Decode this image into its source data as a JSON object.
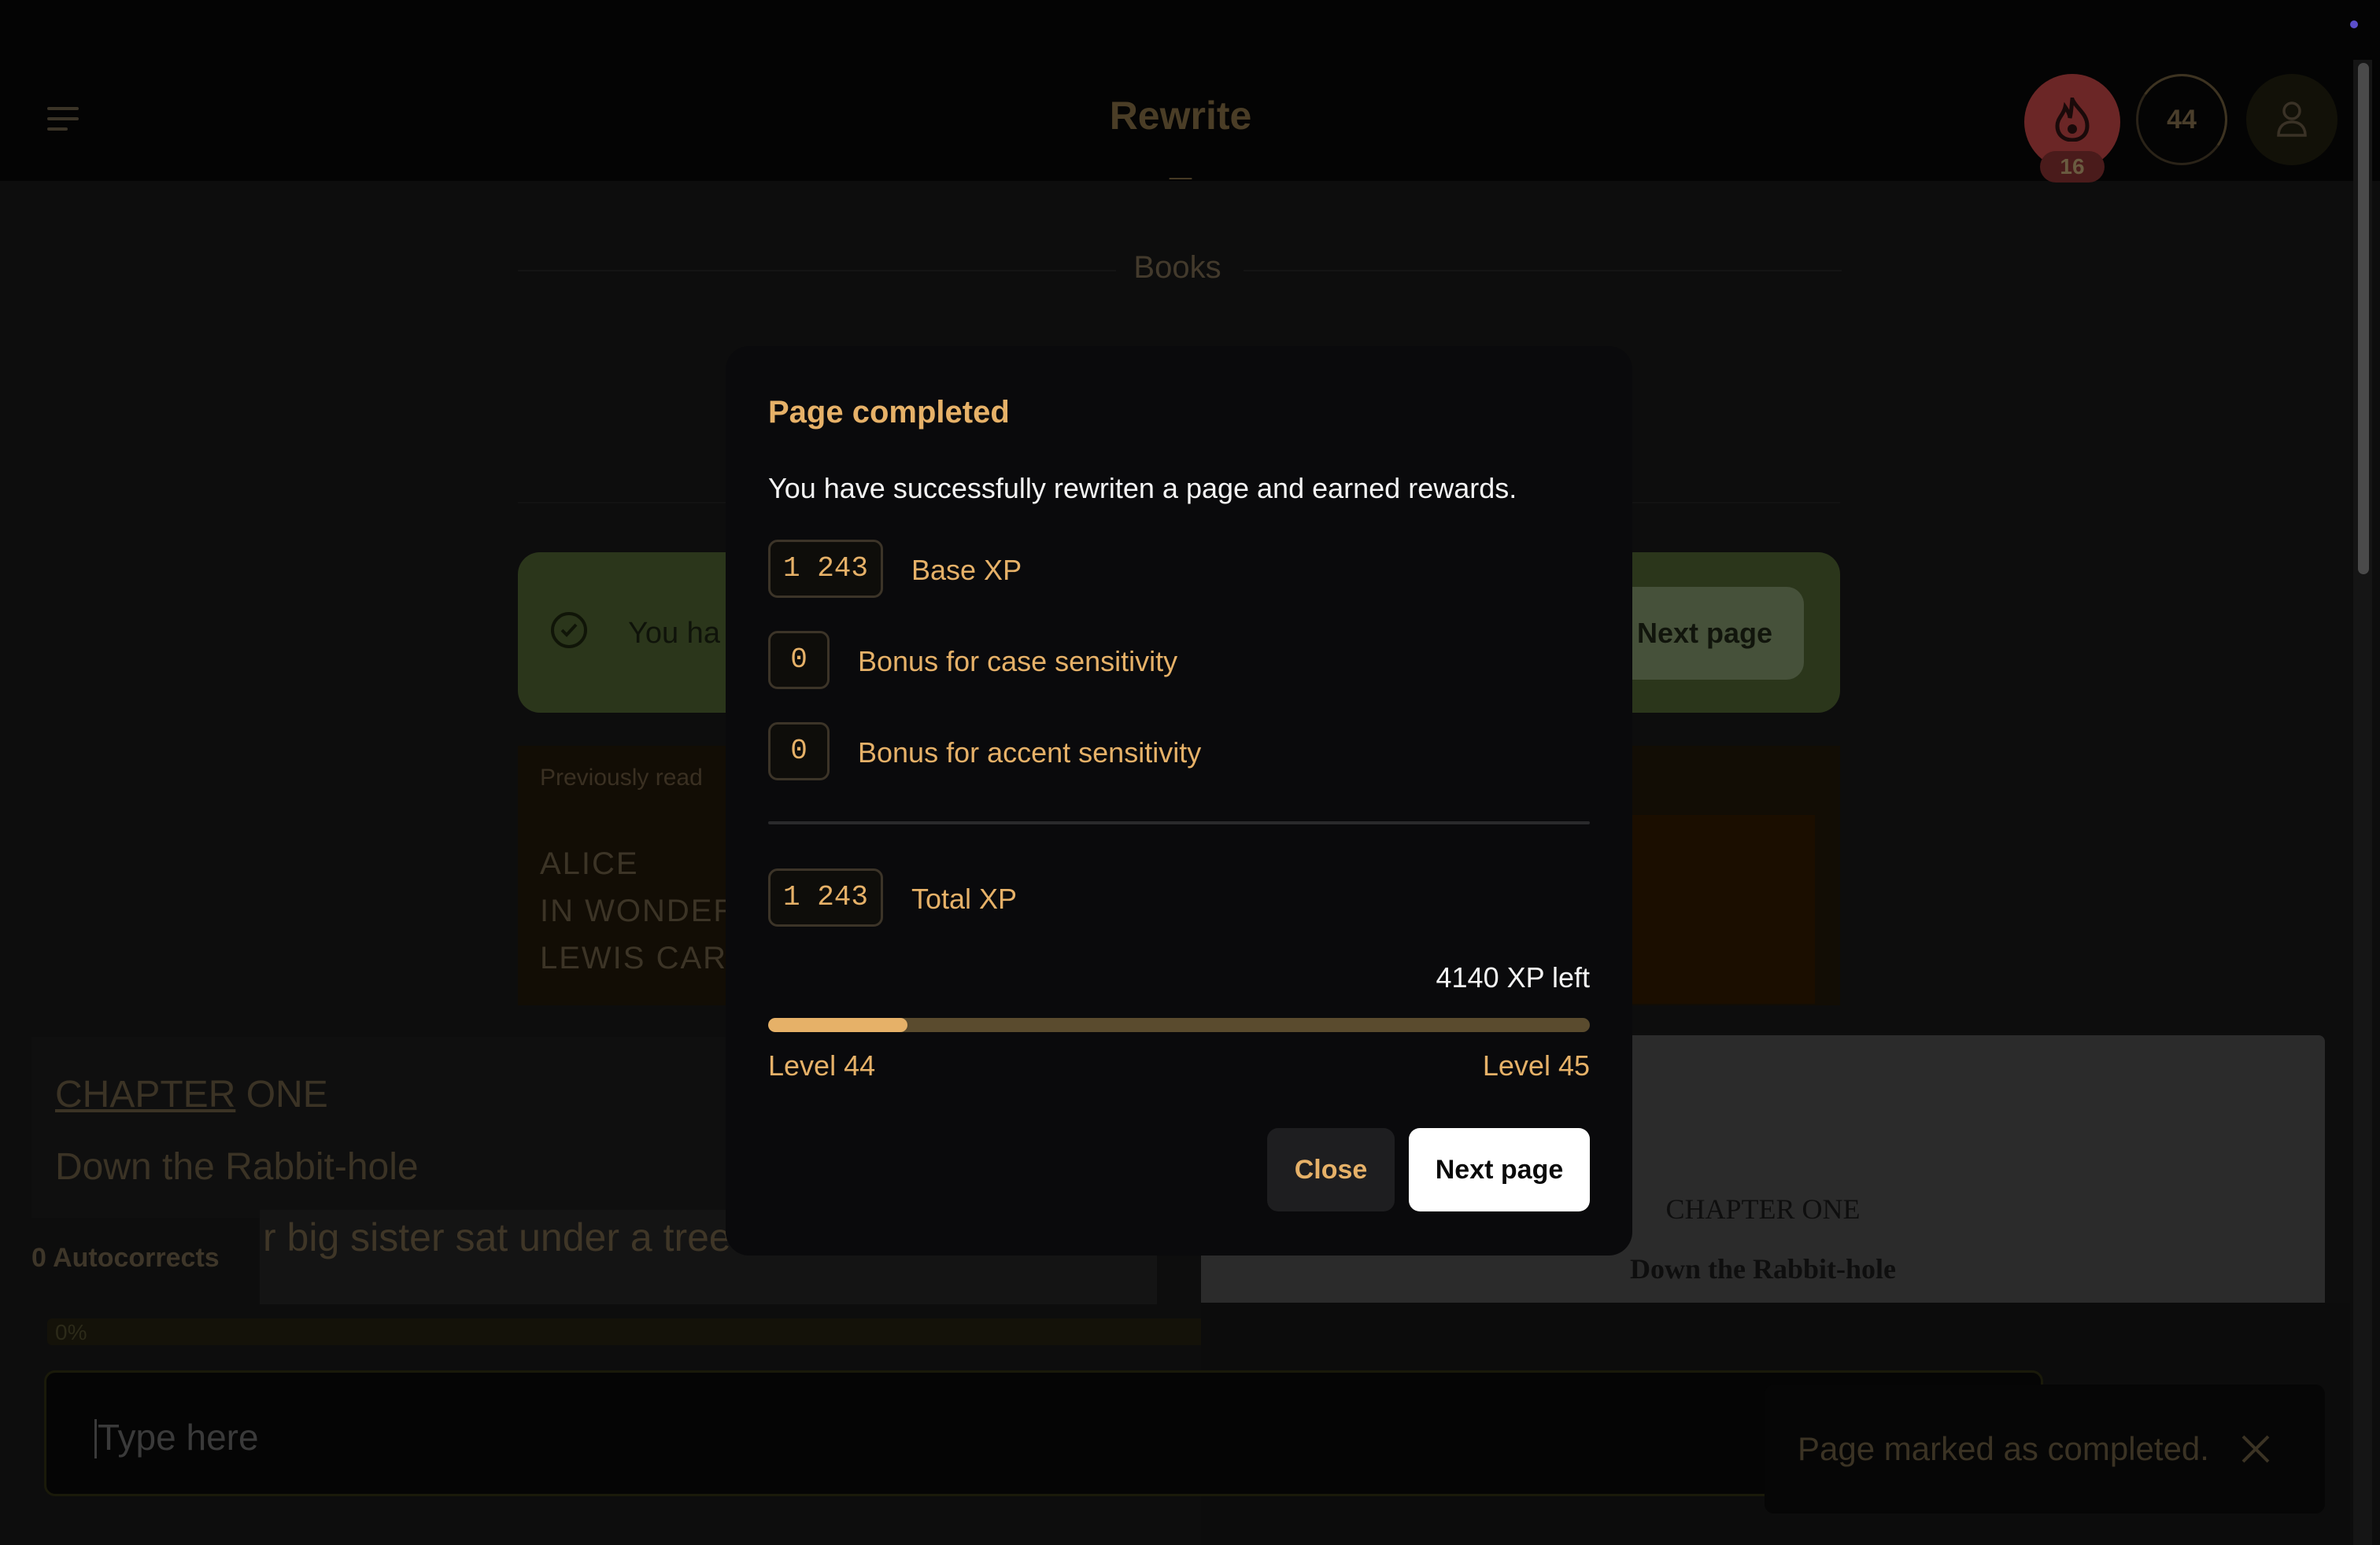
{
  "app": {
    "title": "Rewrite _"
  },
  "header": {
    "streak": "16",
    "level": "44"
  },
  "books": {
    "label": "Books"
  },
  "banner": {
    "text": "You ha",
    "next_label": "Next page"
  },
  "previously_read": {
    "label": "Previously read",
    "lines": [
      "ALICE",
      "IN WONDER",
      "LEWIS CARR"
    ]
  },
  "typing": {
    "chapter_word": "CHAPTER",
    "chapter_rest": " ONE",
    "subtitle": "Down the Rabbit-hole",
    "sentence": "r big sister sat under a tree c",
    "autocorrects": "0 Autocorrects",
    "progress": "0%",
    "progress_value": 0,
    "placeholder": "Type here"
  },
  "preview": {
    "chapter": "CHAPTER ONE",
    "subtitle": "Down the Rabbit-hole"
  },
  "toast": {
    "text": "Page marked as completed."
  },
  "modal": {
    "title": "Page completed",
    "description": "You have successfully rewriten a page and earned rewards.",
    "base_xp": {
      "value": "1 243",
      "label": "Base XP"
    },
    "case_bonus": {
      "value": "0",
      "label": "Bonus for case sensitivity"
    },
    "accent_bonus": {
      "value": "0",
      "label": "Bonus for accent sensitivity"
    },
    "total_xp": {
      "value": "1 243",
      "label": "Total XP"
    },
    "xp_left": "4140 XP left",
    "level_progress": 0.17,
    "level_from": "Level 44",
    "level_to": "Level 45",
    "close_label": "Close",
    "next_label": "Next page"
  },
  "colors": {
    "accent": "#e6b168",
    "modal_bg": "#0a0a0c",
    "button_primary": "#ffffff"
  },
  "icons": {
    "menu": "hamburger-icon",
    "streak": "flame-icon",
    "user": "user-icon",
    "check": "check-circle-icon",
    "toast_close": "close-icon"
  }
}
